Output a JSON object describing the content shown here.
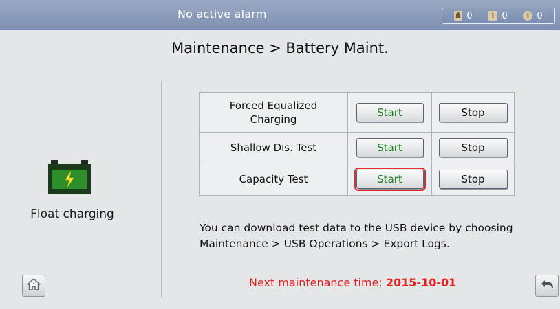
{
  "header": {
    "alarm_status": "No active alarm",
    "counts": [
      {
        "icon": "bell-icon",
        "value": "0"
      },
      {
        "icon": "exclamation-icon",
        "value": "0"
      },
      {
        "icon": "alert-circle-icon",
        "value": "0"
      }
    ]
  },
  "page": {
    "title": "Maintenance > Battery Maint."
  },
  "battery": {
    "icon": "battery-charging-icon",
    "status": "Float charging"
  },
  "operations": [
    {
      "name": "Forced Equalized Charging",
      "start_label": "Start",
      "stop_label": "Stop"
    },
    {
      "name": "Shallow Dis. Test",
      "start_label": "Start",
      "stop_label": "Stop"
    },
    {
      "name": "Capacity Test",
      "start_label": "Start",
      "stop_label": "Stop",
      "selected": "start"
    }
  ],
  "note": "You can download test data to the USB device by choosing Maintenance > USB Operations > Export Logs.",
  "next_maintenance": {
    "label": "Next maintenance time:",
    "date": "2015-10-01"
  },
  "colors": {
    "header": "#8a9bbb",
    "start_text": "#1d7a1d",
    "highlight": "#e22a2a",
    "next_maint_text": "#e32020"
  }
}
